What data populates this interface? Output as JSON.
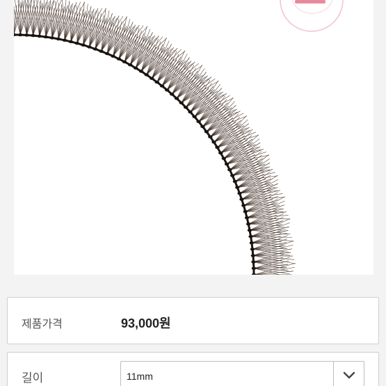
{
  "product": {
    "image_icon": "false-eyelash-strip-image",
    "price_label": "제품가격",
    "price_value": "93,000원"
  },
  "options": {
    "length_label": "길이",
    "length_selected": "11mm",
    "dropdown_icon": "chevron-down-icon"
  },
  "colors": {
    "page_bg": "#f3f3f3",
    "lash_dark": "#1a1410",
    "lash_brown": "#5a4030",
    "stamp_pink": "#e88a9a"
  }
}
